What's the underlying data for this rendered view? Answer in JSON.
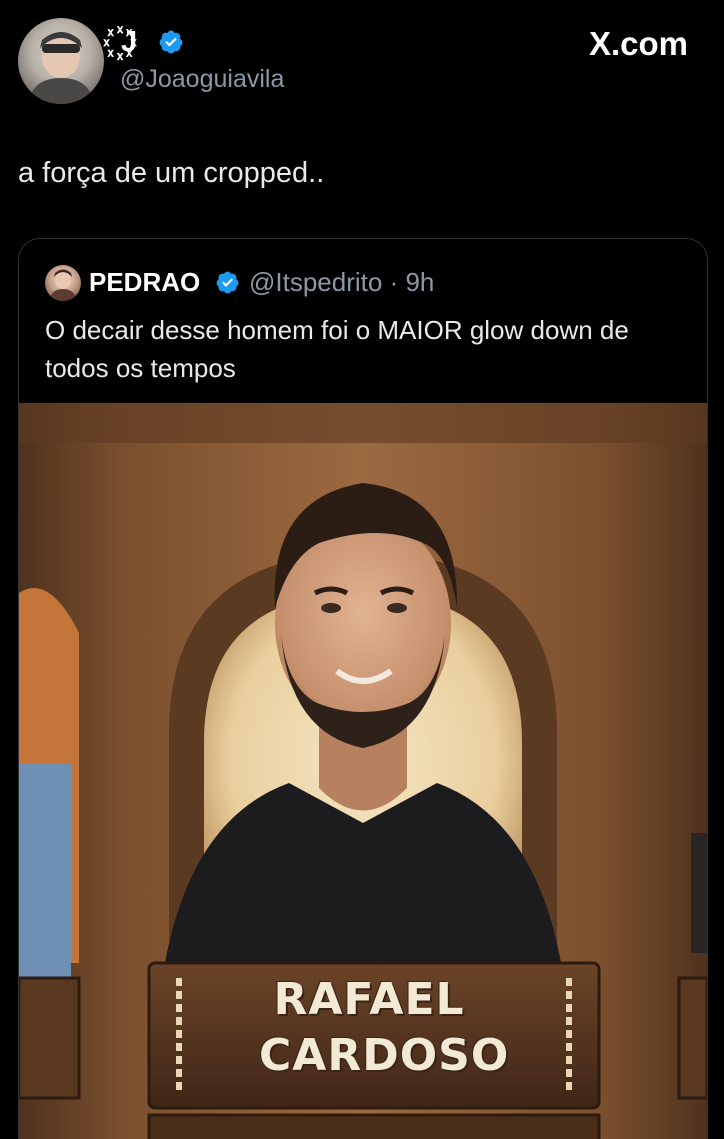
{
  "author": {
    "display_name": "꙰J",
    "handle": "@Joaoguiavila",
    "verified_icon": "verified-badge-icon"
  },
  "brand": {
    "label": "X.com"
  },
  "tweet": {
    "text": "a força de um cropped.."
  },
  "quoted_tweet": {
    "display_name": "PEDRAO",
    "handle_time": "@Itspedrito · 9h",
    "text": "O decair desse homem foi o MAIOR glow down de todos os tempos",
    "media": {
      "nameplate_line_1": "RAFAEL",
      "nameplate_line_2": "CARDOSO"
    }
  },
  "colors": {
    "background": "#000000",
    "text_primary": "#e7e9ea",
    "text_secondary": "#8b98a5",
    "verified_blue": "#1d9bf0",
    "border": "#2f3336"
  }
}
